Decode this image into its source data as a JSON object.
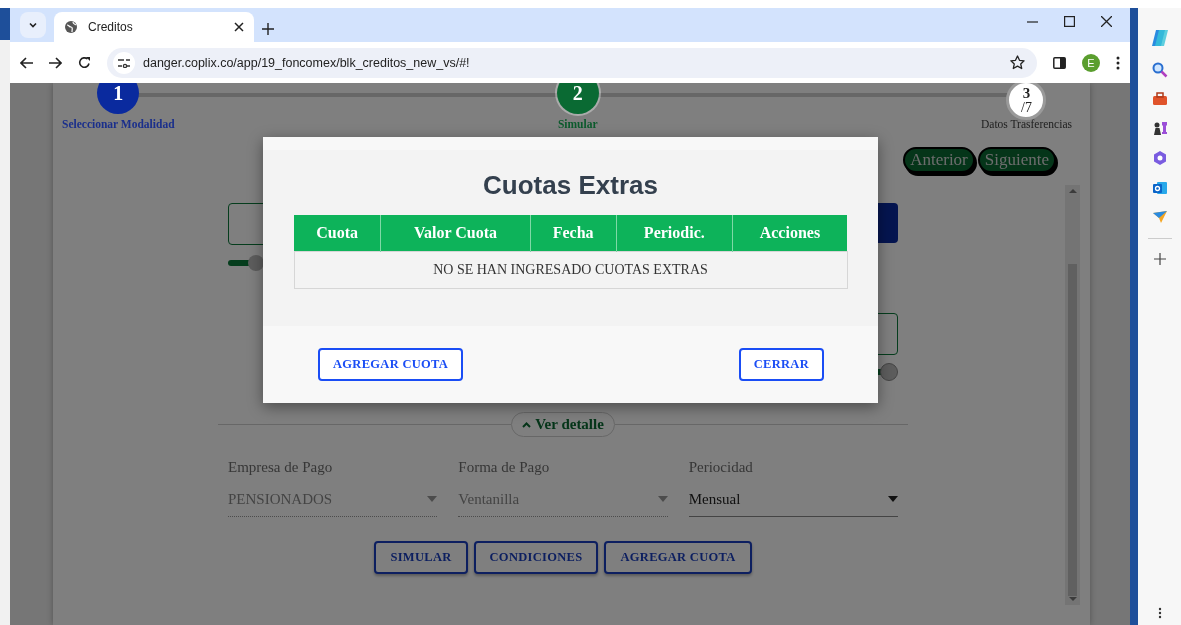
{
  "browser": {
    "tab_title": "Creditos",
    "url": "danger.coplix.co/app/19_foncomex/blk_creditos_new_vs/#!",
    "profile_initial": "E"
  },
  "stepper": {
    "steps": [
      {
        "number": "1",
        "label": "Seleccionar Modalidad",
        "completed": true,
        "selected": false
      },
      {
        "number": "2",
        "label": "Simular",
        "completed": false,
        "selected": true
      },
      {
        "number": "3",
        "total": "/7",
        "label": "Datos Trasferencias",
        "completed": false,
        "selected": false
      }
    ]
  },
  "nav_buttons": [
    "Anterior",
    "Siguiente"
  ],
  "details_toggle": "Ver detalle",
  "fields": [
    {
      "label": "Empresa de Pago",
      "value": "PENSIONADOS",
      "disabled": true
    },
    {
      "label": "Forma de Pago",
      "value": "Ventanilla",
      "disabled": true
    },
    {
      "label": "Periocidad",
      "value": "Mensual",
      "disabled": false
    }
  ],
  "actions": [
    "SIMULAR",
    "CONDICIONES",
    "AGREGAR CUOTA"
  ],
  "modal": {
    "title": "Cuotas Extras",
    "columns": [
      "Cuota",
      "Valor Cuota",
      "Fecha",
      "Periodic.",
      "Acciones"
    ],
    "empty_message": "NO SE HAN INGRESADO CUOTAS EXTRAS",
    "buttons": [
      "AGREGAR CUOTA",
      "CERRAR"
    ]
  }
}
